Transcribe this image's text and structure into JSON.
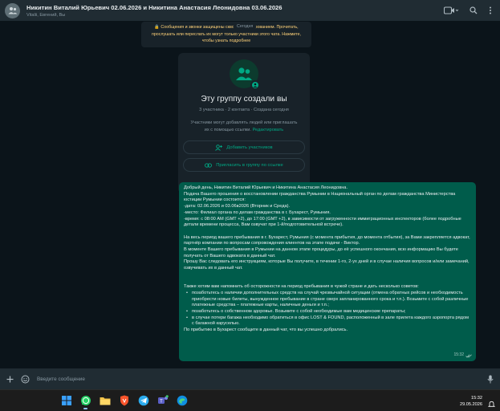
{
  "header": {
    "title": "Никитин Виталий Юрьевич 02.06.2026 и Никитина Анастасия Леонидовна 03.06.2026",
    "subtitle": "Vitalii, Евгений, Вы",
    "icons": [
      "group-avatar-icon",
      "video-call-icon",
      "search-icon",
      "menu-icon"
    ]
  },
  "chat": {
    "day_label": "Сегодня",
    "encryption_notice": "🔒 Сообщения и звонки защищены сквозным шифрованием. Прочитать, прослушать или переслать их могут только участники этого чата. Нажмите, чтобы узнать подробнее",
    "group_card": {
      "title": "Эту группу создали вы",
      "meta": "3 участника · 2 контакта · Создана сегодня",
      "description": "Участники могут добавлять людей или приглашать их с помощью ссылки.",
      "edit_link": "Редактировать",
      "add_members": "Добавить участников",
      "invite_link": "Пригласить в группу по ссылке"
    },
    "message": {
      "lines": [
        "Добрый день, Никитин Виталий Юрьевич и Никитина Анастасия Леонидовна.",
        "Подача Вашего прошения о восстановлении гражданства Румынии в Национальный орган по делам гражданства Министерства юстиции Румынии состоится:",
        "-дата: 02.06.2026 и 03.06в2026 (Вторник и Среда).",
        "-место: Филиал органа по делам гражданства в г. Бухарест, Румыния.",
        "-время: с 08:00 AM (GMT +2), до 17:00 (GMT +2), в зависимости от загруженности иммиграционных инспекторов (более подробные детали времени процесса, Вам озвучат при 1-й/подготовительной встрече).",
        "На весь период вашего пребывания в г. Бухарест, Румыния (с момента прибытия, до момента отбытия), за Вами закрепляется адвокат, партнёр компании по вопросам сопровождения клиентов на этапе подачи - Виктор.",
        "В моменте Вашего пребывания в Румынии на данном этапе процедуры, до её успешного окончания, всю информацию Вы будете получать от Вашего адвоката в данный чат.",
        "Прошу Вас следовать его инструкциям, которые Вы получите, в течении 1-го, 2-ух дней и в случае наличия вопросов и/или замечаний, озвучивать их в данный чат.",
        "Также хотим вам напомнить об осторожности на период пребывания в чужой стране и дать несколько советов:"
      ],
      "bullets": [
        "позаботьтесь о наличии дополнительных средств на случай чрезвычайной ситуации (отмена обратных рейсов и необходимость приобрести новые билеты, вынужденное пребывание в стране сверх запланированного срока и т.п.). Возьмите с собой различные платежные средства – платежные карты, наличные деньги и т.п.;",
        "позаботьтесь о собственном здоровье. Возьмите с собой необходимые вам медицинские препараты;",
        "в случае потери багажа необходимо обратиться в офис LOST & FOUND, расположенный в зале прилета каждого аэропорта рядом с багажной каруселью."
      ],
      "closing": "По прибытию в Бухарест сообщите в данный чат, что вы успешно добрались.",
      "time": "15:32"
    }
  },
  "input": {
    "placeholder": "Введите сообщение"
  },
  "taskbar": {
    "time": "15:32",
    "date": "29.05.2026",
    "apps": [
      "windows-start-icon",
      "whatsapp-icon",
      "file-explorer-icon",
      "brave-browser-icon",
      "telegram-icon",
      "teams-icon",
      "edge-browser-icon"
    ]
  },
  "colors": {
    "accent": "#00a884",
    "bubble_out": "#005c4b",
    "header_bg": "#202c33",
    "chat_bg": "#0b141a",
    "notice_text": "#ffd279"
  }
}
